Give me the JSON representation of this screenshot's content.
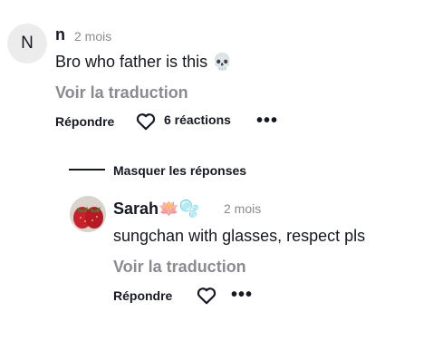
{
  "comment": {
    "avatar_initial": "N",
    "username": "n",
    "time": "2 mois",
    "text": "Bro who father is this 💀",
    "translate_label": "Voir la traduction",
    "reply_label": "Répondre",
    "reactions_label": "6 réactions",
    "more_label": "•••"
  },
  "replies_toggle": {
    "label": "Masquer les réponses"
  },
  "reply": {
    "username": "Sarah🪷🫧",
    "time": "2 mois",
    "text": "sungchan with glasses, respect pls",
    "translate_label": "Voir la traduction",
    "reply_label": "Répondre",
    "more_label": "•••"
  }
}
